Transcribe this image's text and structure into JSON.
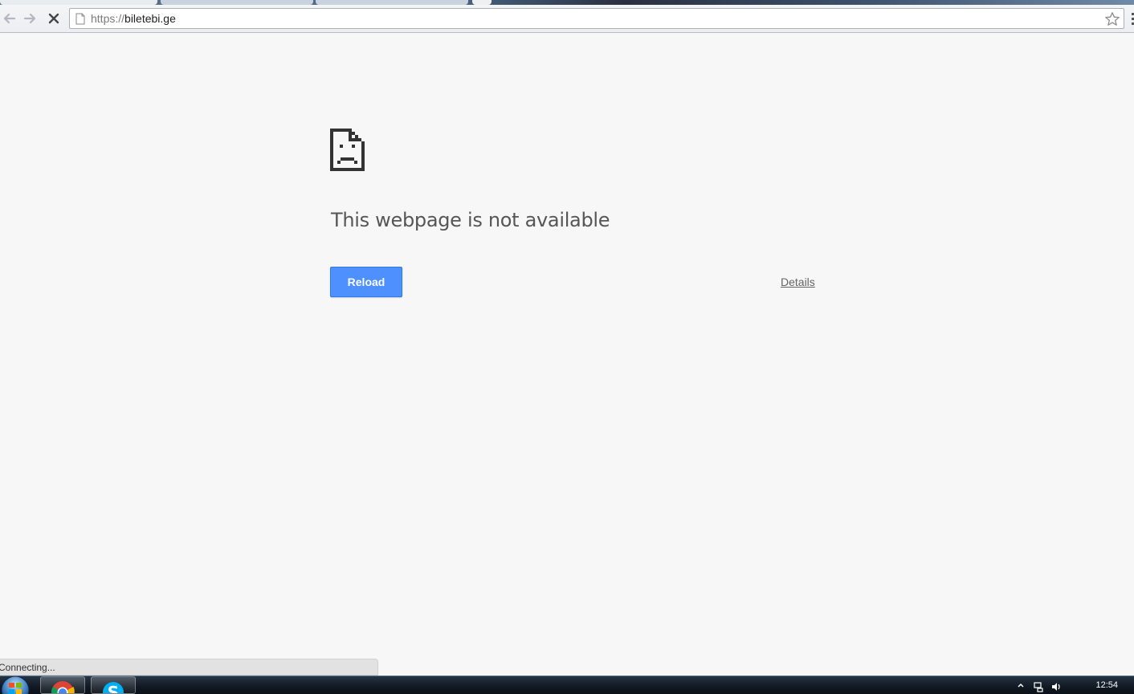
{
  "browser": {
    "url_scheme": "https://",
    "url_host": "biletebi.ge",
    "status_text": "Connecting..."
  },
  "error_page": {
    "heading": "This webpage is not available",
    "reload_label": "Reload",
    "details_label": "Details"
  },
  "taskbar": {
    "clock": "12:54",
    "pinned": [
      "start-orb",
      "chrome-icon",
      "skype-icon"
    ]
  },
  "colors": {
    "reload_button": "#4d90fe",
    "page_background": "#f7f7f7",
    "heading_text": "#565656"
  }
}
